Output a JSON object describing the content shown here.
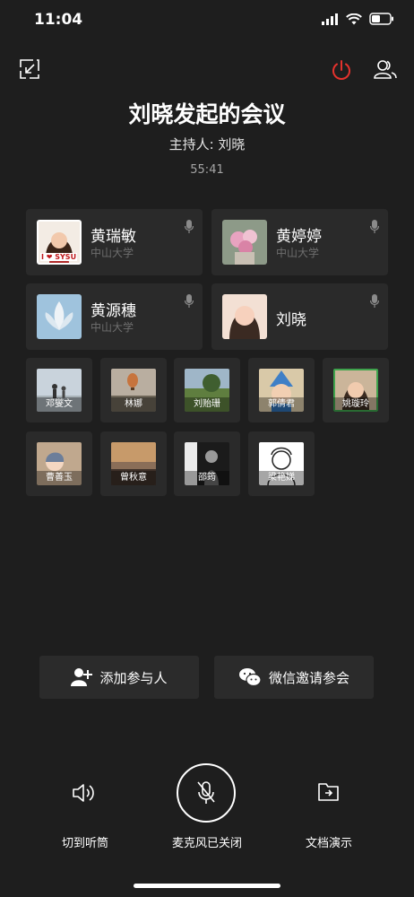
{
  "status": {
    "time": "11:04"
  },
  "meeting": {
    "title": "刘晓发起的会议",
    "host": "主持人: 刘晓",
    "elapsed": "55:41"
  },
  "featured": [
    {
      "name": "黄瑞敏",
      "org": "中山大学",
      "badge": "I ❤ SYSU"
    },
    {
      "name": "黄婷婷",
      "org": "中山大学"
    },
    {
      "name": "黄源穗",
      "org": "中山大学"
    },
    {
      "name": "刘晓",
      "org": ""
    }
  ],
  "participants": [
    "邓燮文",
    "林娜",
    "刘贻珊",
    "郭倩君",
    "姚璇玲",
    "曹善玉",
    "曾秋意",
    "邵筠",
    "梁艳娣"
  ],
  "actions": {
    "add": "添加参与人",
    "wechat": "微信邀请参会"
  },
  "controls": {
    "speaker": "切到听筒",
    "mic": "麦克风已关闭",
    "share": "文档演示"
  },
  "colors": {
    "power": "#e5322d",
    "background": "#1e1e1e",
    "card": "#2a2a2a"
  }
}
